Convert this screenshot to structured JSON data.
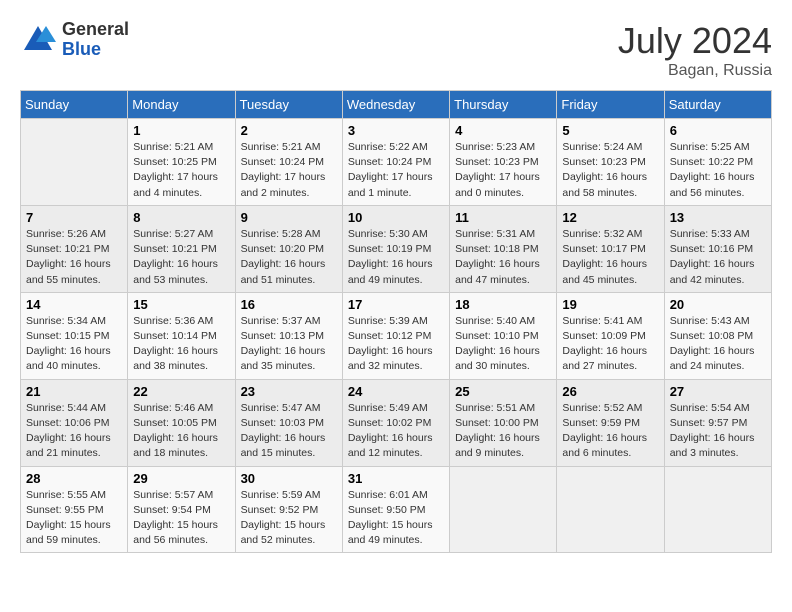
{
  "header": {
    "logo_general": "General",
    "logo_blue": "Blue",
    "month_year": "July 2024",
    "location": "Bagan, Russia"
  },
  "weekdays": [
    "Sunday",
    "Monday",
    "Tuesday",
    "Wednesday",
    "Thursday",
    "Friday",
    "Saturday"
  ],
  "weeks": [
    [
      {
        "day": "",
        "info": ""
      },
      {
        "day": "1",
        "info": "Sunrise: 5:21 AM\nSunset: 10:25 PM\nDaylight: 17 hours\nand 4 minutes."
      },
      {
        "day": "2",
        "info": "Sunrise: 5:21 AM\nSunset: 10:24 PM\nDaylight: 17 hours\nand 2 minutes."
      },
      {
        "day": "3",
        "info": "Sunrise: 5:22 AM\nSunset: 10:24 PM\nDaylight: 17 hours\nand 1 minute."
      },
      {
        "day": "4",
        "info": "Sunrise: 5:23 AM\nSunset: 10:23 PM\nDaylight: 17 hours\nand 0 minutes."
      },
      {
        "day": "5",
        "info": "Sunrise: 5:24 AM\nSunset: 10:23 PM\nDaylight: 16 hours\nand 58 minutes."
      },
      {
        "day": "6",
        "info": "Sunrise: 5:25 AM\nSunset: 10:22 PM\nDaylight: 16 hours\nand 56 minutes."
      }
    ],
    [
      {
        "day": "7",
        "info": "Sunrise: 5:26 AM\nSunset: 10:21 PM\nDaylight: 16 hours\nand 55 minutes."
      },
      {
        "day": "8",
        "info": "Sunrise: 5:27 AM\nSunset: 10:21 PM\nDaylight: 16 hours\nand 53 minutes."
      },
      {
        "day": "9",
        "info": "Sunrise: 5:28 AM\nSunset: 10:20 PM\nDaylight: 16 hours\nand 51 minutes."
      },
      {
        "day": "10",
        "info": "Sunrise: 5:30 AM\nSunset: 10:19 PM\nDaylight: 16 hours\nand 49 minutes."
      },
      {
        "day": "11",
        "info": "Sunrise: 5:31 AM\nSunset: 10:18 PM\nDaylight: 16 hours\nand 47 minutes."
      },
      {
        "day": "12",
        "info": "Sunrise: 5:32 AM\nSunset: 10:17 PM\nDaylight: 16 hours\nand 45 minutes."
      },
      {
        "day": "13",
        "info": "Sunrise: 5:33 AM\nSunset: 10:16 PM\nDaylight: 16 hours\nand 42 minutes."
      }
    ],
    [
      {
        "day": "14",
        "info": "Sunrise: 5:34 AM\nSunset: 10:15 PM\nDaylight: 16 hours\nand 40 minutes."
      },
      {
        "day": "15",
        "info": "Sunrise: 5:36 AM\nSunset: 10:14 PM\nDaylight: 16 hours\nand 38 minutes."
      },
      {
        "day": "16",
        "info": "Sunrise: 5:37 AM\nSunset: 10:13 PM\nDaylight: 16 hours\nand 35 minutes."
      },
      {
        "day": "17",
        "info": "Sunrise: 5:39 AM\nSunset: 10:12 PM\nDaylight: 16 hours\nand 32 minutes."
      },
      {
        "day": "18",
        "info": "Sunrise: 5:40 AM\nSunset: 10:10 PM\nDaylight: 16 hours\nand 30 minutes."
      },
      {
        "day": "19",
        "info": "Sunrise: 5:41 AM\nSunset: 10:09 PM\nDaylight: 16 hours\nand 27 minutes."
      },
      {
        "day": "20",
        "info": "Sunrise: 5:43 AM\nSunset: 10:08 PM\nDaylight: 16 hours\nand 24 minutes."
      }
    ],
    [
      {
        "day": "21",
        "info": "Sunrise: 5:44 AM\nSunset: 10:06 PM\nDaylight: 16 hours\nand 21 minutes."
      },
      {
        "day": "22",
        "info": "Sunrise: 5:46 AM\nSunset: 10:05 PM\nDaylight: 16 hours\nand 18 minutes."
      },
      {
        "day": "23",
        "info": "Sunrise: 5:47 AM\nSunset: 10:03 PM\nDaylight: 16 hours\nand 15 minutes."
      },
      {
        "day": "24",
        "info": "Sunrise: 5:49 AM\nSunset: 10:02 PM\nDaylight: 16 hours\nand 12 minutes."
      },
      {
        "day": "25",
        "info": "Sunrise: 5:51 AM\nSunset: 10:00 PM\nDaylight: 16 hours\nand 9 minutes."
      },
      {
        "day": "26",
        "info": "Sunrise: 5:52 AM\nSunset: 9:59 PM\nDaylight: 16 hours\nand 6 minutes."
      },
      {
        "day": "27",
        "info": "Sunrise: 5:54 AM\nSunset: 9:57 PM\nDaylight: 16 hours\nand 3 minutes."
      }
    ],
    [
      {
        "day": "28",
        "info": "Sunrise: 5:55 AM\nSunset: 9:55 PM\nDaylight: 15 hours\nand 59 minutes."
      },
      {
        "day": "29",
        "info": "Sunrise: 5:57 AM\nSunset: 9:54 PM\nDaylight: 15 hours\nand 56 minutes."
      },
      {
        "day": "30",
        "info": "Sunrise: 5:59 AM\nSunset: 9:52 PM\nDaylight: 15 hours\nand 52 minutes."
      },
      {
        "day": "31",
        "info": "Sunrise: 6:01 AM\nSunset: 9:50 PM\nDaylight: 15 hours\nand 49 minutes."
      },
      {
        "day": "",
        "info": ""
      },
      {
        "day": "",
        "info": ""
      },
      {
        "day": "",
        "info": ""
      }
    ]
  ]
}
